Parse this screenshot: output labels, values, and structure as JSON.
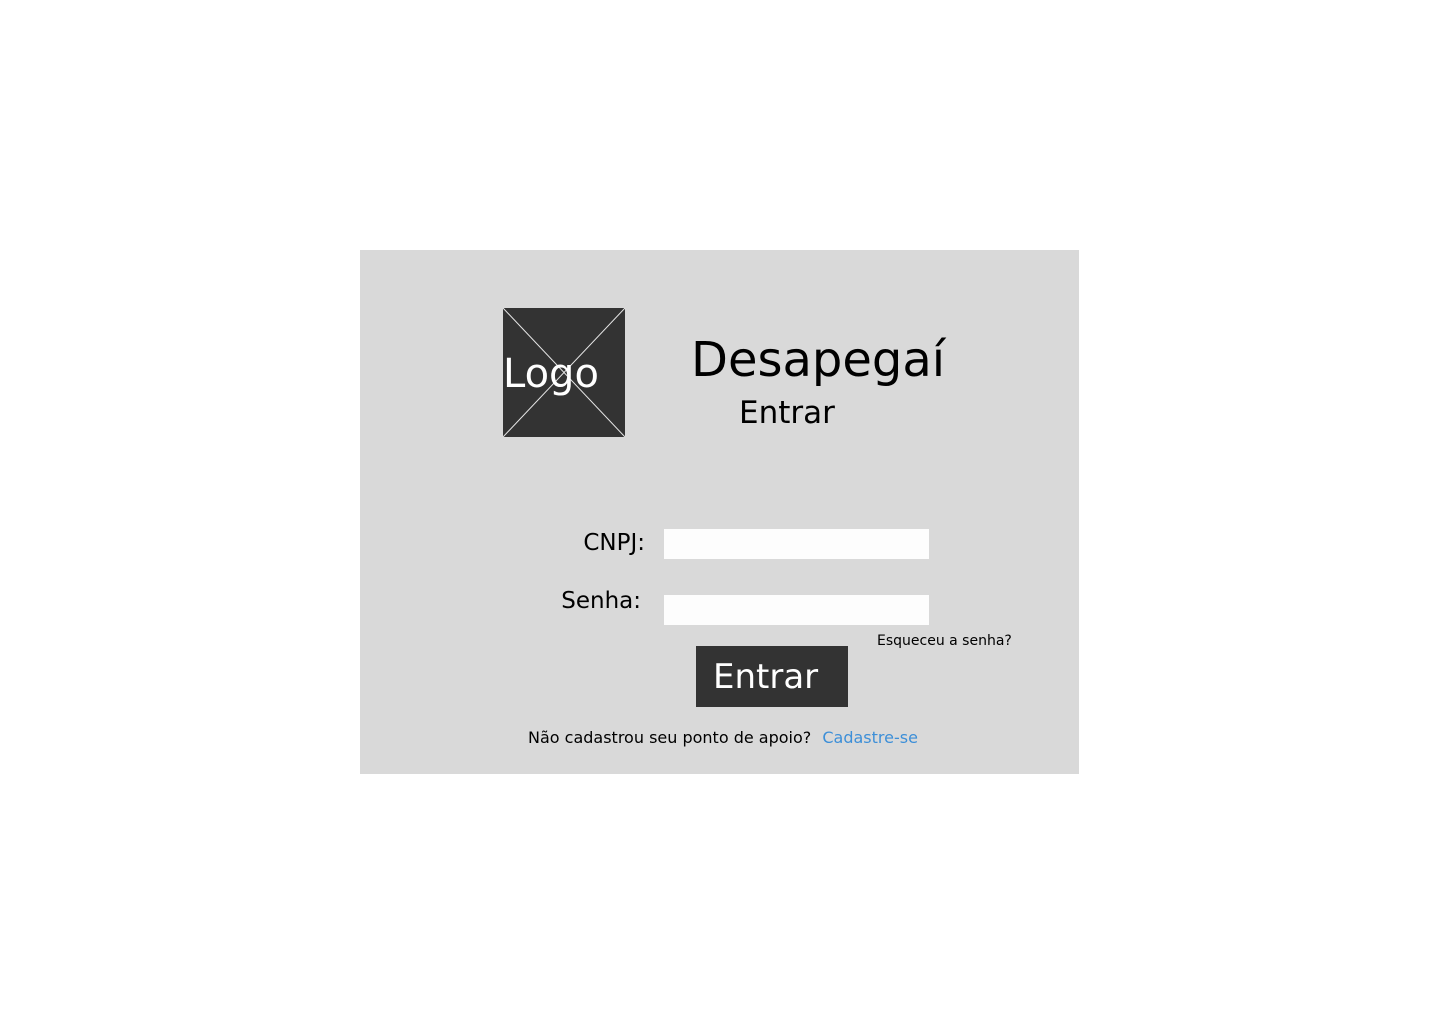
{
  "logo": {
    "placeholder_label": "Logo"
  },
  "header": {
    "title": "Desapegaí",
    "subtitle": "Entrar"
  },
  "form": {
    "cnpj_label": "CNPJ:",
    "cnpj_value": "",
    "password_label": "Senha:",
    "password_value": "",
    "forgot_password_link": "Esqueceu a senha?",
    "submit_label": "Entrar"
  },
  "footer": {
    "register_prompt": "Não cadastrou seu ponto de apoio?",
    "register_link": "Cadastre-se"
  },
  "colors": {
    "card_background": "#d9d9d9",
    "dark": "#333333",
    "link": "#3d8fd8",
    "input_background": "#fdfdfd"
  }
}
